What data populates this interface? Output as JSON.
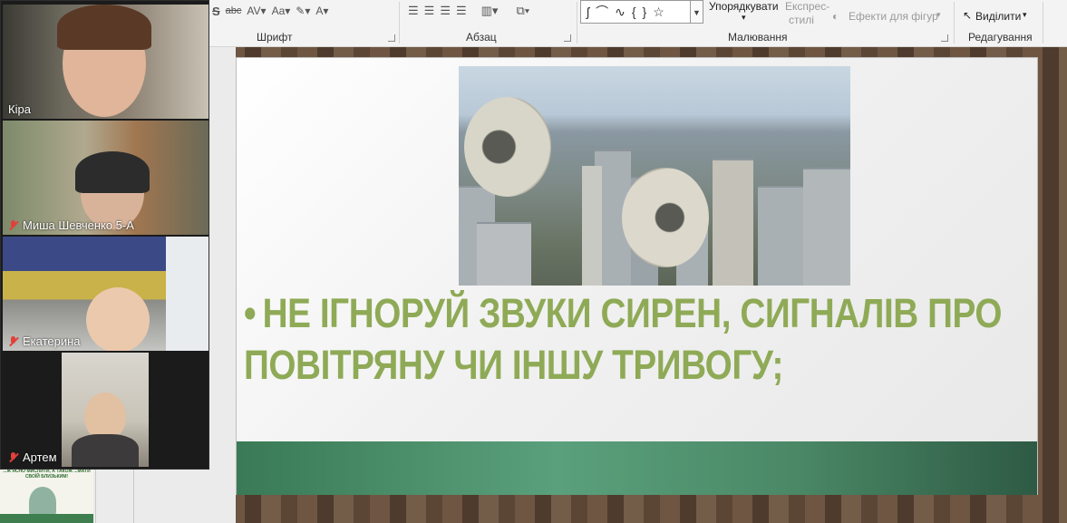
{
  "ribbon": {
    "groups": {
      "font": "Шрифт",
      "paragraph": "Абзац",
      "drawing": "Малювання",
      "editing": "Редагування"
    },
    "drawing_buttons": {
      "arrange": "Упорядкувати",
      "quick_styles_line1": "Експрес-",
      "quick_styles_line2": "стилі",
      "shape_effects": "Ефекти для фігур"
    },
    "editing_buttons": {
      "select": "Виділити"
    }
  },
  "slide": {
    "bullet_line1": "НЕ ІГНОРУЙ ЗВУКИ СИРЕН, СИГНАЛІВ ПРО",
    "bullet_line2": "ПОВІТРЯНУ ЧИ ІНШУ ТРИВОГУ;",
    "bullet_symbol": "•",
    "accent_color": "#8faa56",
    "band_color": "#4a8866",
    "photo_icon": "loudspeaker-city-photo"
  },
  "participants": [
    {
      "name": "Кіра",
      "muted": false
    },
    {
      "name": "Миша Шевченко 5-А",
      "muted": true
    },
    {
      "name": "Екатерина",
      "muted": true
    },
    {
      "name": "Артем",
      "muted": true
    }
  ],
  "mini_slide_text": "...Ж ЯСНО МИСЛИТИ, А ТАКОЖ ...МАТИ СВОЇЙ БЛИЗЬКИМ!"
}
